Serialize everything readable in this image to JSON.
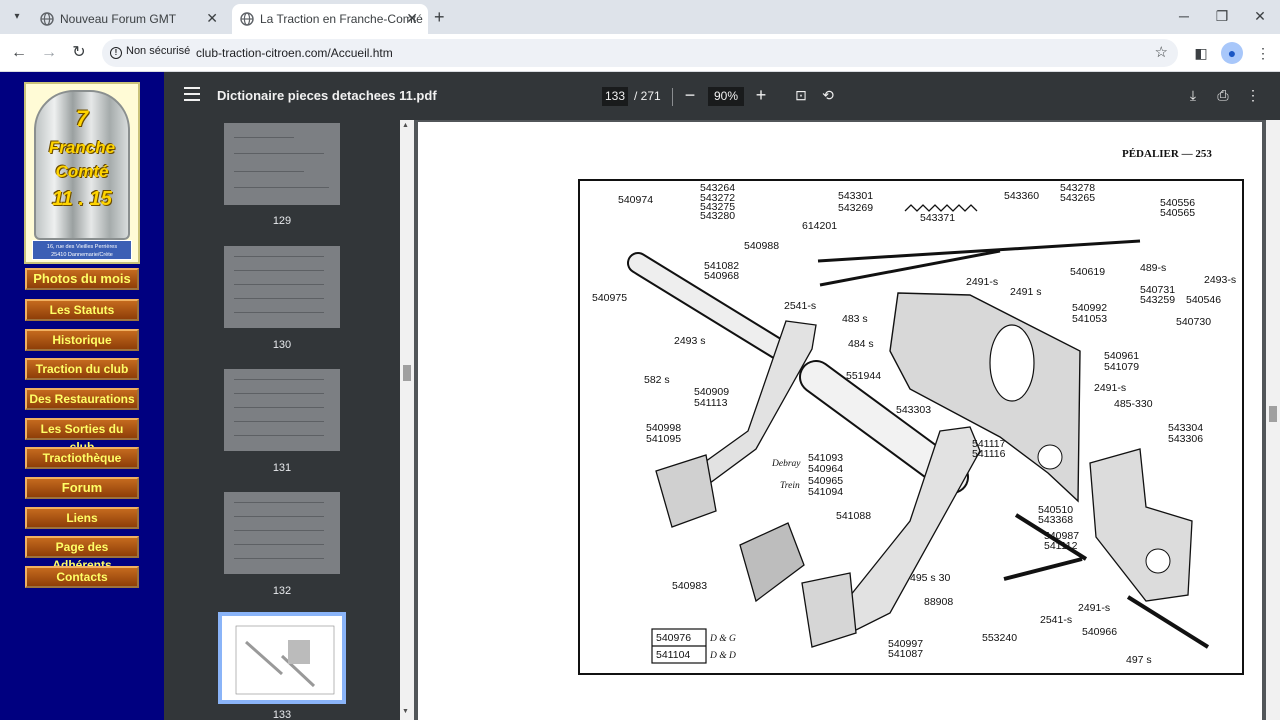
{
  "browser": {
    "tabs": [
      {
        "title": "Nouveau Forum GMT",
        "active": false
      },
      {
        "title": "La Traction en Franche-Comté",
        "active": true
      }
    ],
    "security_label": "Non sécurisé",
    "url": "club-traction-citroen.com/Accueil.htm",
    "new_tab_symbol": "+",
    "close_symbol": "✕"
  },
  "site": {
    "logo": {
      "line1": "7",
      "line2": "Franche",
      "line3": "Comté",
      "line4": "11 . 15",
      "address_line1": "16, rue des Vieilles Perrières",
      "address_line2": "25410 Dannemarie/Crète"
    },
    "menu": [
      "Photos du mois",
      "Les Statuts",
      "Historique",
      "Traction du club",
      "Des Restaurations",
      "Les Sorties du club",
      "Tractiothèque",
      "Forum",
      "Liens",
      "Page des Adhérents",
      "Contacts"
    ]
  },
  "pdf": {
    "title": "Dictionaire pieces detachees 11.pdf",
    "current_page": "133",
    "total_pages": "/ 271",
    "zoom": "90%",
    "thumbnails": [
      "129",
      "130",
      "131",
      "132",
      "133"
    ],
    "selected_thumbnail": "133",
    "page_heading": "PÉDALIER — 253",
    "part_labels": [
      "540974",
      "540975",
      "543264",
      "543272",
      "543275",
      "543280",
      "543301",
      "543269",
      "543360",
      "543278",
      "543265",
      "540556",
      "540565",
      "614201",
      "543371",
      "540988",
      "541082",
      "540968",
      "2491-s",
      "2541-s",
      "483 s",
      "540619",
      "489-s",
      "2493-s",
      "2491 s",
      "540992",
      "541053",
      "540731",
      "543259",
      "540546",
      "540730",
      "2493 s",
      "484 s",
      "582 s",
      "540909",
      "541113",
      "551944",
      "540961",
      "541079",
      "2491-s",
      "485-330",
      "543303",
      "540998",
      "541095",
      "541093",
      "540964",
      "540965",
      "541094",
      "541117",
      "541116",
      "543304",
      "543306",
      "541088",
      "540510",
      "543368",
      "540987",
      "541112",
      "540983",
      "495 s 30",
      "88908",
      "2491-s",
      "540966",
      "553240",
      "2541-s",
      "540997",
      "541087",
      "497 s",
      "540976",
      "541104"
    ],
    "annotations": [
      "Debray",
      "Trein",
      "D & G",
      "D & D"
    ]
  }
}
